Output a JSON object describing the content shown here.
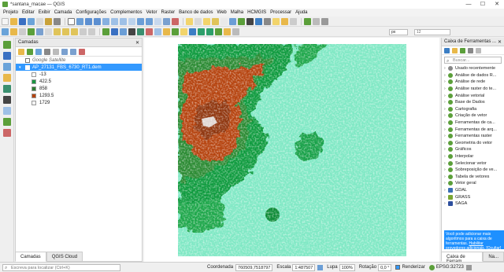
{
  "window": {
    "title": "*santana_macae — QGIS",
    "controls": [
      "—",
      "☐",
      "✕"
    ]
  },
  "menu": [
    "Projeto",
    "Editar",
    "Exibir",
    "Camada",
    "Configurações",
    "Complementos",
    "Vetor",
    "Raster",
    "Banco de dados",
    "Web",
    "Malha",
    "HCMGIS",
    "Processar",
    "Ajuda"
  ],
  "toolbar": {
    "zoom_value": "12",
    "unit": "px"
  },
  "layers_panel": {
    "title": "Camadas",
    "layers": [
      {
        "name": "Google Satellite",
        "checked": false
      },
      {
        "name": "AP_27131_FBS_6730_RT1.dem",
        "checked": true
      }
    ],
    "legend": [
      {
        "value": "-13",
        "color": "#ffffff"
      },
      {
        "value": "422.5",
        "color": "#1a9641"
      },
      {
        "value": "858",
        "color": "#2e7d32"
      },
      {
        "value": "1293.5",
        "color": "#b5430f"
      },
      {
        "value": "1729",
        "color": "#f2f2f2"
      }
    ],
    "tabs": [
      "Camadas",
      "QGIS Cloud"
    ]
  },
  "toolbox": {
    "title": "Caixa de Ferramentas ...",
    "search_placeholder": "Buscar...",
    "items": [
      {
        "label": "Usado recentemente",
        "kind": "recent"
      },
      {
        "label": "Análise de dados R...",
        "kind": "qgs"
      },
      {
        "label": "Análise de rede",
        "kind": "qgs"
      },
      {
        "label": "Análise raster do te...",
        "kind": "qgs"
      },
      {
        "label": "Análise vetorial",
        "kind": "qgs"
      },
      {
        "label": "Base de Dados",
        "kind": "qgs"
      },
      {
        "label": "Cartografia",
        "kind": "qgs"
      },
      {
        "label": "Criação de vetor",
        "kind": "qgs"
      },
      {
        "label": "Ferramentas de ca...",
        "kind": "qgs"
      },
      {
        "label": "Ferramentas de arq...",
        "kind": "qgs"
      },
      {
        "label": "Ferramentas raster",
        "kind": "qgs"
      },
      {
        "label": "Geometria do vetor",
        "kind": "qgs"
      },
      {
        "label": "Gráficos",
        "kind": "qgs"
      },
      {
        "label": "Interpolar",
        "kind": "qgs"
      },
      {
        "label": "Selecionar vetor",
        "kind": "qgs"
      },
      {
        "label": "Sobreposição de ve...",
        "kind": "qgs"
      },
      {
        "label": "Tabela de vetores",
        "kind": "qgs"
      },
      {
        "label": "Vetor geral",
        "kind": "qgs"
      },
      {
        "label": "GDAL",
        "kind": "gdal"
      },
      {
        "label": "GRASS",
        "kind": "grass"
      },
      {
        "label": "SAGA",
        "kind": "saga"
      }
    ],
    "info_text": "Você pode adicionar mais algoritmos para a caixa de ferramentas.",
    "info_link1": "Habilitar",
    "info_link2": "provedores adicionais.",
    "info_link3": "[Ocultar]",
    "tabs": [
      "Caixa de Ferram...",
      "Na..."
    ]
  },
  "status": {
    "search_placeholder": "Escreva para localizar (Ctrl+K)",
    "coord_label": "Coordenada",
    "coord_value": "760509,7518797",
    "scale_label": "Escala",
    "scale_value": "1:487507",
    "magnifier_label": "Lupa",
    "magnifier_value": "100%",
    "rotation_label": "Rotação",
    "rotation_value": "0,0 °",
    "render_label": "Renderizar",
    "crs": "EPSG:32723"
  }
}
